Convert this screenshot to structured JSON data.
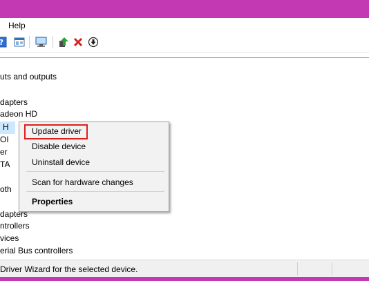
{
  "menu": {
    "help": "Help"
  },
  "toolbar": {
    "icons": [
      "help-icon",
      "properties-icon",
      "scan-icon",
      "update-driver-icon",
      "uninstall-icon",
      "download-icon"
    ],
    "colors": {
      "update": "#2e9e36",
      "uninstall": "#d81e1e"
    }
  },
  "tree": {
    "items": [
      "uts and outputs",
      "dapters",
      "adeon HD",
      "H",
      "OI",
      "er",
      "TA",
      "oth",
      "dapters",
      "ntrollers",
      "vices",
      "erial Bus controllers"
    ]
  },
  "context_menu": {
    "items": [
      "Update driver",
      "Disable device",
      "Uninstall device",
      "Scan for hardware changes",
      "Properties"
    ],
    "highlight_color": "#e01d1d"
  },
  "status": {
    "text": "Driver Wizard for the selected device."
  },
  "theme": {
    "accent": "#c239b3",
    "selection": "#cce8ff"
  }
}
